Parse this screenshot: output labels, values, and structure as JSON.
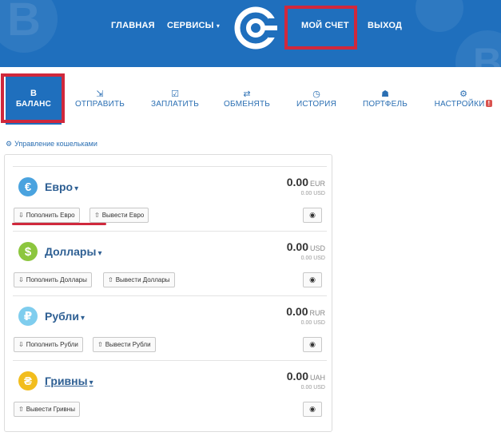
{
  "header": {
    "nav": {
      "home": "ГЛАВНАЯ",
      "services": "СЕРВИСЫ",
      "account": "МОЙ СЧЕТ",
      "logout": "ВЫХОД"
    },
    "brand_color": "#1f6fbd",
    "highlight_color": "#d0283c"
  },
  "tabs": [
    {
      "label": "БАЛАНС",
      "icon": "bitcoin-icon",
      "active": true
    },
    {
      "label": "ОТПРАВИТЬ",
      "icon": "send-icon"
    },
    {
      "label": "ЗАПЛАТИТЬ",
      "icon": "pay-check-icon"
    },
    {
      "label": "ОБМЕНЯТЬ",
      "icon": "exchange-icon"
    },
    {
      "label": "ИСТОРИЯ",
      "icon": "clock-icon"
    },
    {
      "label": "ПОРТФЕЛЬ",
      "icon": "wallet-icon"
    },
    {
      "label": "НАСТРОЙКИ",
      "icon": "gear-icon",
      "badge": "!"
    }
  ],
  "manage_wallets": "Управление кошельками",
  "wallets": [
    {
      "name": "Евро",
      "symbol": "€",
      "color": "#4aa3df",
      "amount": "0.00",
      "currency": "EUR",
      "sub_amount": "0.00 USD",
      "topup": "Пополнить Евро",
      "withdraw": "Вывести Евро"
    },
    {
      "name": "Доллары",
      "symbol": "$",
      "color": "#8cc63e",
      "amount": "0.00",
      "currency": "USD",
      "sub_amount": "0.00 USD",
      "topup": "Пополнить Доллары",
      "withdraw": "Вывести Доллары"
    },
    {
      "name": "Рубли",
      "symbol": "₽",
      "color": "#7fcdee",
      "amount": "0.00",
      "currency": "RUR",
      "sub_amount": "0.00 USD",
      "topup": "Пополнить Рубли",
      "withdraw": "Вывести Рубли"
    },
    {
      "name": "Гривны",
      "symbol": "₴",
      "color": "#f2bd1d",
      "amount": "0.00",
      "currency": "UAH",
      "sub_amount": "0.00 USD",
      "withdraw": "Вывести Гривны"
    }
  ]
}
